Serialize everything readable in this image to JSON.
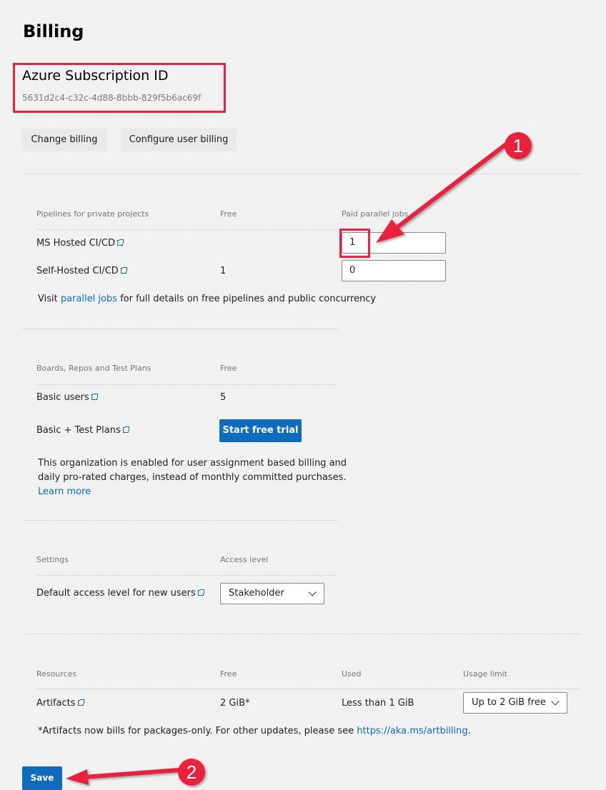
{
  "page_title": "Billing",
  "subscription": {
    "title": "Azure Subscription ID",
    "id": "5631d2c4-c32c-4d88-8bbb-829f5b6ac69f"
  },
  "actions": {
    "change_billing": "Change billing",
    "configure_user_billing": "Configure user billing"
  },
  "pipelines": {
    "headers": [
      "Pipelines for private projects",
      "Free",
      "Paid parallel jobs"
    ],
    "ms_hosted": {
      "label": "MS Hosted CI/CD",
      "free": "",
      "paid": "1"
    },
    "self_hosted": {
      "label": "Self-Hosted CI/CD",
      "free": "1",
      "paid": "0"
    },
    "note_prefix": "Visit ",
    "note_link": "parallel jobs",
    "note_suffix": " for full details on free pipelines and public concurrency"
  },
  "boards": {
    "headers": [
      "Boards, Repos and Test Plans",
      "Free"
    ],
    "basic_users": {
      "label": "Basic users",
      "free": "5"
    },
    "basic_test": {
      "label": "Basic + Test Plans",
      "button": "Start free trial"
    },
    "note_line1": "This organization is enabled for user assignment based billing and",
    "note_line2": "daily pro-rated charges, instead of monthly committed purchases.",
    "learn_more": "Learn more"
  },
  "settings": {
    "headers": [
      "Settings",
      "Access level"
    ],
    "default_access": {
      "label": "Default access level for new users",
      "value": "Stakeholder"
    }
  },
  "resources": {
    "headers": [
      "Resources",
      "Free",
      "Used",
      "Usage limit"
    ],
    "artifacts": {
      "label": "Artifacts",
      "free": "2 GiB*",
      "used": "Less than 1 GiB",
      "limit": "Up to 2 GiB free"
    },
    "note_prefix": "*Artifacts now bills for packages-only. For other updates, please see ",
    "note_link": "https://aka.ms/artbilling",
    "note_suffix": "."
  },
  "save_label": "Save",
  "callouts": [
    "1",
    "2"
  ],
  "colors": {
    "accent": "#0f6cbd",
    "annotation_red": "#e8233d"
  }
}
